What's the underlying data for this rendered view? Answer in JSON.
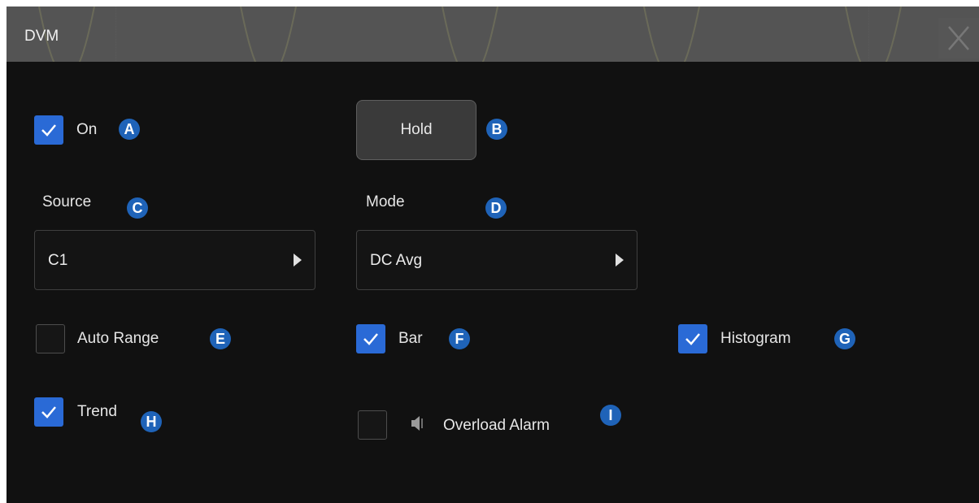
{
  "window": {
    "title": "DVM",
    "close_label": "X"
  },
  "controls": {
    "on": {
      "label": "On",
      "checked": true,
      "badge": "A"
    },
    "hold": {
      "label": "Hold",
      "badge": "B"
    },
    "source": {
      "label": "Source",
      "value": "C1",
      "badge": "C"
    },
    "mode": {
      "label": "Mode",
      "value": "DC Avg",
      "badge": "D"
    },
    "auto_range": {
      "label": "Auto Range",
      "checked": false,
      "badge": "E"
    },
    "bar": {
      "label": "Bar",
      "checked": true,
      "badge": "F"
    },
    "histogram": {
      "label": "Histogram",
      "checked": true,
      "badge": "G"
    },
    "trend": {
      "label": "Trend",
      "checked": true,
      "badge": "H"
    },
    "overload_alarm": {
      "label": "Overload Alarm",
      "checked": false,
      "badge": "I",
      "icon": "speaker-icon"
    }
  },
  "colors": {
    "accent": "#2a6ad6",
    "badge": "#1f63b8",
    "waveform": "#8a8a2a"
  }
}
